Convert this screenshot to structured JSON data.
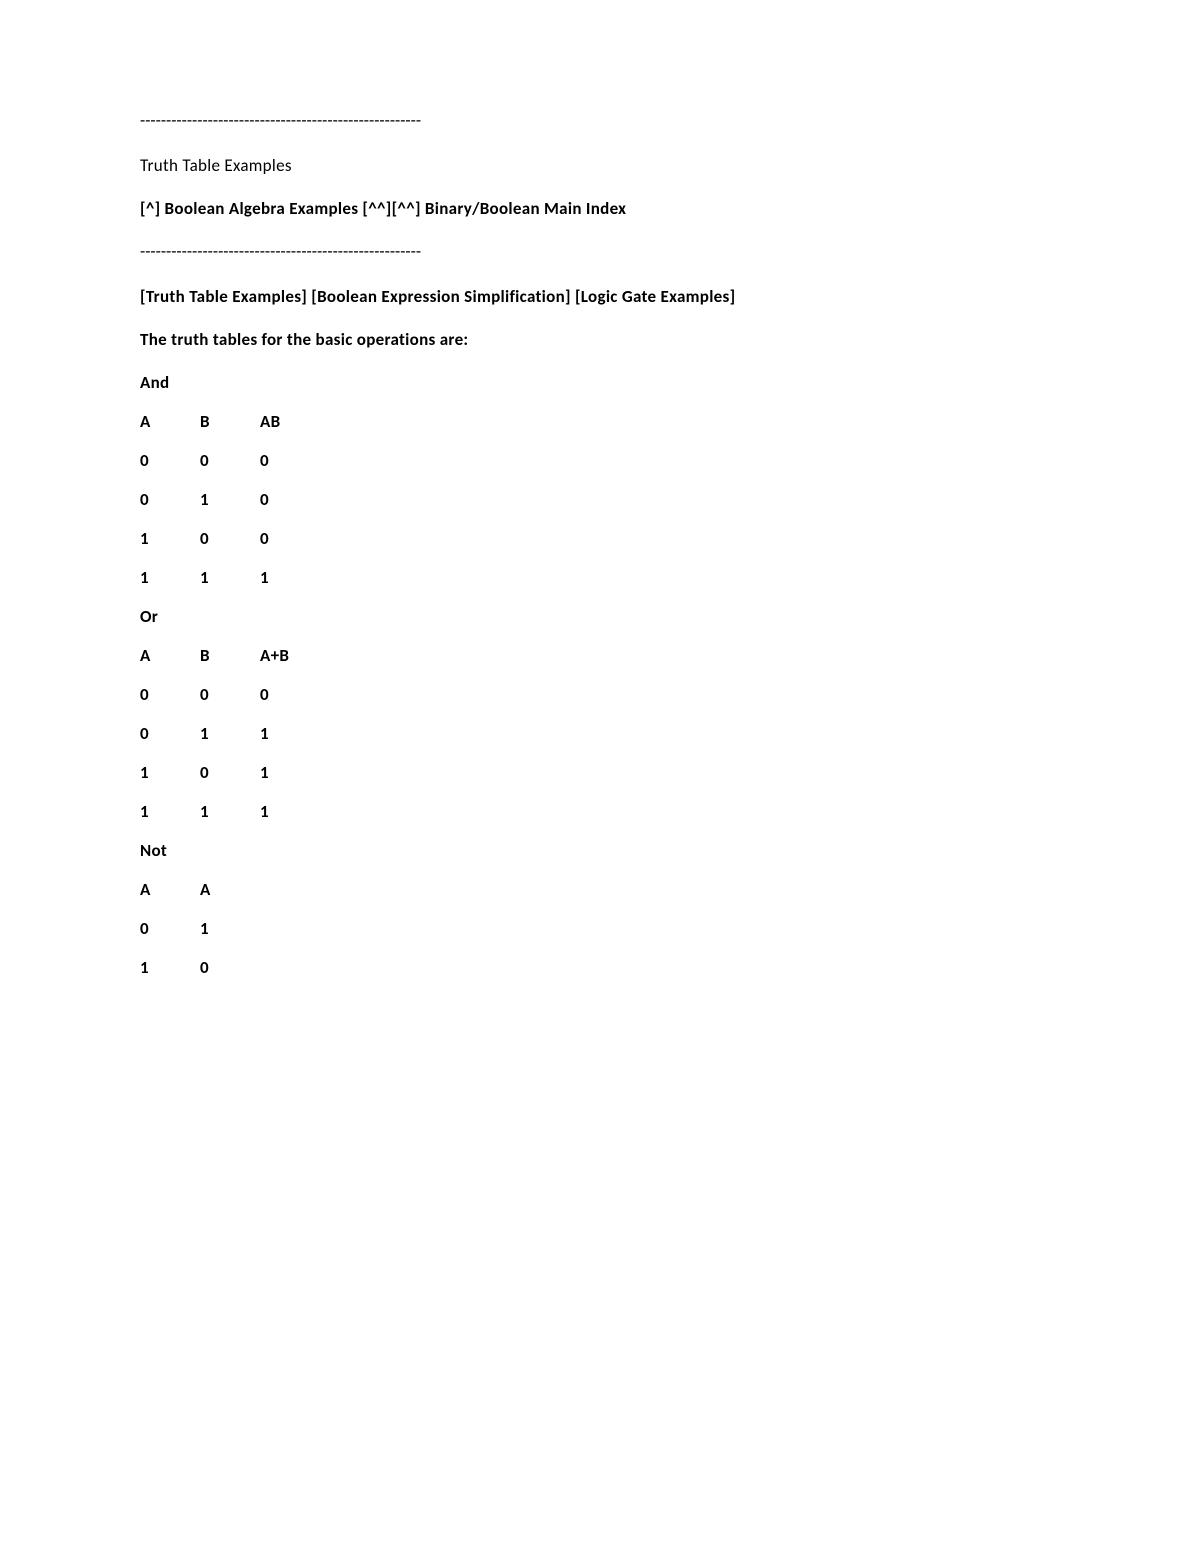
{
  "rule1": "------------------------------------------------------",
  "title": "Truth Table Examples",
  "nav_links": "[^] Boolean Algebra Examples   [^^][^^] Binary/Boolean Main Index",
  "rule2": "------------------------------------------------------",
  "section_links": "[Truth Table Examples] [Boolean Expression Simplification] [Logic Gate Examples]",
  "intro": "The truth tables for the basic operations are:",
  "tables": {
    "and": {
      "label": "And",
      "headers": [
        "A",
        "B",
        "AB"
      ],
      "rows": [
        [
          "0",
          "0",
          "0"
        ],
        [
          "0",
          "1",
          "0"
        ],
        [
          "1",
          "0",
          "0"
        ],
        [
          "1",
          "1",
          "1"
        ]
      ]
    },
    "or": {
      "label": "Or",
      "headers": [
        "A",
        "B",
        "A+B"
      ],
      "rows": [
        [
          "0",
          "0",
          "0"
        ],
        [
          "0",
          "1",
          "1"
        ],
        [
          "1",
          "0",
          "1"
        ],
        [
          "1",
          "1",
          "1"
        ]
      ]
    },
    "not": {
      "label": "Not",
      "headers": [
        "A",
        "A"
      ],
      "rows": [
        [
          "0",
          "1"
        ],
        [
          "1",
          "0"
        ]
      ]
    }
  }
}
